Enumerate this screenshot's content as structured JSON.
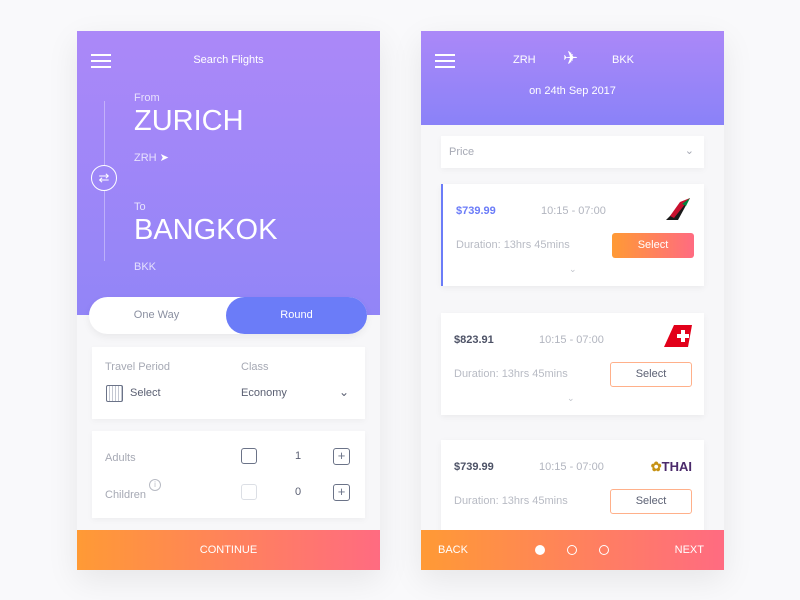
{
  "search": {
    "title": "Search Flights",
    "from_label": "From",
    "from_city": "ZURICH",
    "from_code": "ZRH",
    "to_label": "To",
    "to_city": "BANGKOK",
    "to_code": "BKK",
    "trip_types": [
      "One Way",
      "Round"
    ],
    "selected_trip": "Round",
    "travel_period_label": "Travel Period",
    "travel_period_value": "Select",
    "class_label": "Class",
    "class_value": "Economy",
    "adults_label": "Adults",
    "adults_count": "1",
    "children_label": "Children",
    "children_count": "0",
    "continue": "CONTINUE"
  },
  "results": {
    "from_code": "ZRH",
    "to_code": "BKK",
    "date": "on 24th Sep 2017",
    "sort_label": "Price",
    "flights": [
      {
        "price": "$739.99",
        "time": "10:15 - 07:00",
        "duration": "Duration: 13hrs 45mins",
        "select": "Select",
        "airline": "Emirates",
        "selected": true
      },
      {
        "price": "$823.91",
        "time": "10:15 - 07:00",
        "duration": "Duration: 13hrs 45mins",
        "select": "Select",
        "airline": "Swiss"
      },
      {
        "price": "$739.99",
        "time": "10:15 - 07:00",
        "duration": "Duration: 13hrs 45mins",
        "select": "Select",
        "airline": "THAI"
      }
    ],
    "back": "BACK",
    "next": "NEXT",
    "page": 1,
    "pages": 3
  },
  "colors": {
    "accent": "#6b7cf8",
    "gradient_start": "#ff9a35",
    "gradient_end": "#ff6b81",
    "header": "#a488f8"
  }
}
